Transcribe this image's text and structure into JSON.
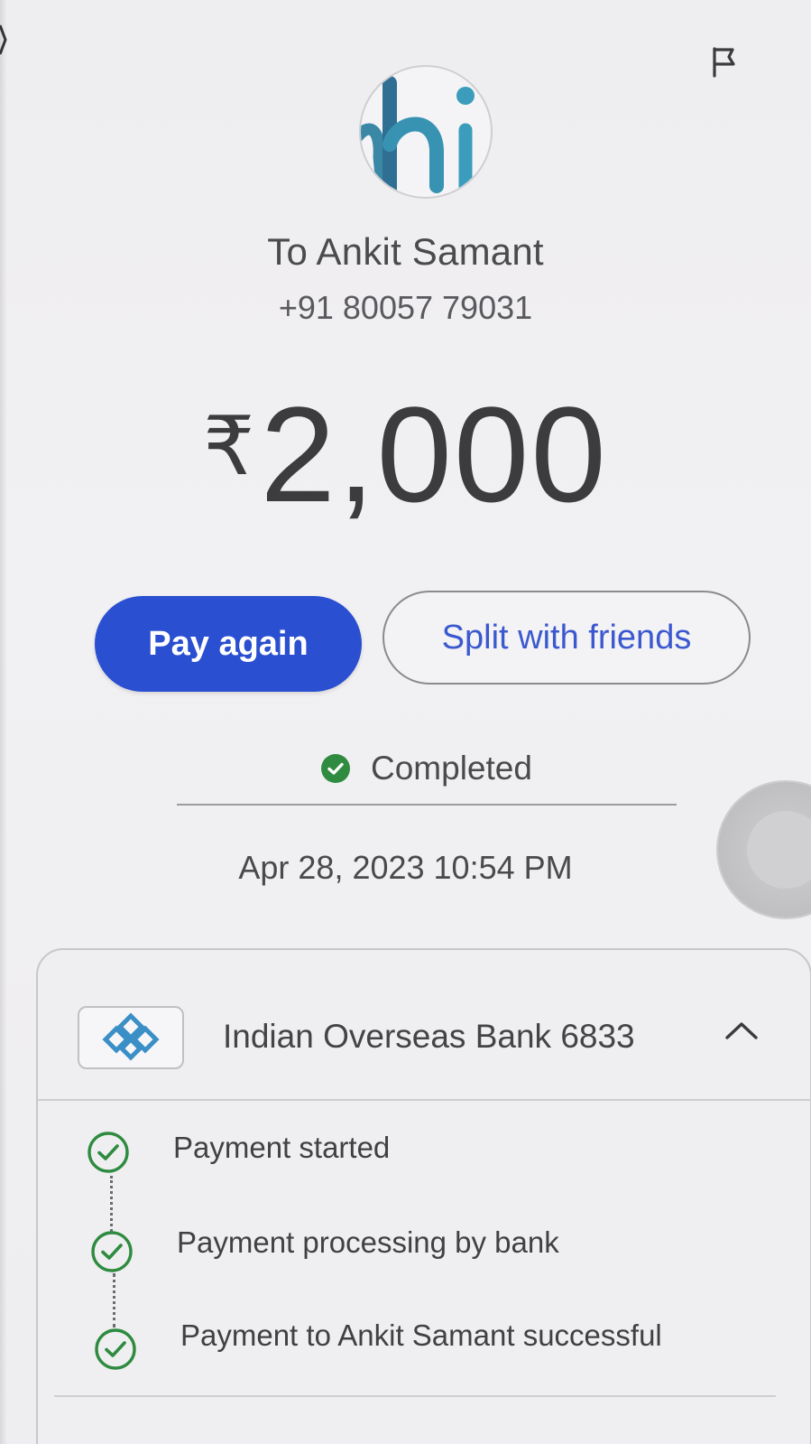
{
  "header": {
    "flag_icon": "flag-icon"
  },
  "recipient": {
    "avatar_text": "hi",
    "name": "To Ankit Samant",
    "phone": "+91 80057 79031"
  },
  "amount": {
    "currency": "₹",
    "value": "2,000"
  },
  "actions": {
    "pay_again": "Pay again",
    "split": "Split with friends"
  },
  "status": {
    "text": "Completed",
    "color": "#2e8b3f"
  },
  "datetime": "Apr 28, 2023 10:54 PM",
  "bank": {
    "name": "Indian Overseas Bank 6833",
    "expand_icon": "chevron-up-icon"
  },
  "steps": [
    {
      "label": "Payment started"
    },
    {
      "label": "Payment processing by bank"
    },
    {
      "label": "Payment to Ankit Samant successful"
    }
  ],
  "colors": {
    "primary": "#2a4fd0",
    "link": "#3b59cf",
    "success": "#2e8b3f"
  }
}
